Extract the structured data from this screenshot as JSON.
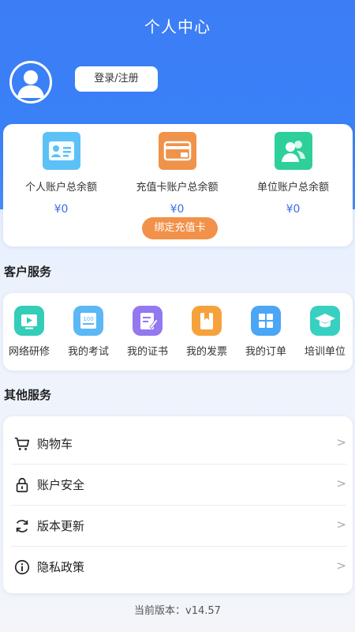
{
  "header": {
    "title": "个人中心",
    "login_label": "登录/注册",
    "bg_color": "#3a80f7"
  },
  "accounts": [
    {
      "label": "个人账户总余额",
      "amount": "¥0",
      "icon": "id-card-icon",
      "color": "#5cc1f7"
    },
    {
      "label": "充值卡账户总余额",
      "amount": "¥0",
      "icon": "wallet-card-icon",
      "color": "#f0934a"
    },
    {
      "label": "单位账户总余额",
      "amount": "¥0",
      "icon": "users-icon",
      "color": "#2ecf9a"
    }
  ],
  "bind_card_label": "绑定充值卡",
  "customer_service": {
    "title": "客户服务",
    "items": [
      {
        "label": "网络研修",
        "icon": "video-icon",
        "color": "#33cdb8"
      },
      {
        "label": "我的考试",
        "icon": "exam-icon",
        "color": "#5cb7f5"
      },
      {
        "label": "我的证书",
        "icon": "certificate-icon",
        "color": "#9378f0"
      },
      {
        "label": "我的发票",
        "icon": "invoice-icon",
        "color": "#f6a23c"
      },
      {
        "label": "我的订单",
        "icon": "orders-icon",
        "color": "#4ba6f5"
      },
      {
        "label": "培训单位",
        "icon": "graduation-cap-icon",
        "color": "#38d0c0"
      }
    ]
  },
  "other_service": {
    "title": "其他服务",
    "items": [
      {
        "label": "购物车",
        "icon": "cart-icon",
        "chevron": ">"
      },
      {
        "label": "账户安全",
        "icon": "lock-icon",
        "chevron": ">"
      },
      {
        "label": "版本更新",
        "icon": "refresh-icon",
        "chevron": ">"
      },
      {
        "label": "隐私政策",
        "icon": "info-icon",
        "chevron": ">"
      }
    ]
  },
  "version_text": "当前版本：v14.57"
}
